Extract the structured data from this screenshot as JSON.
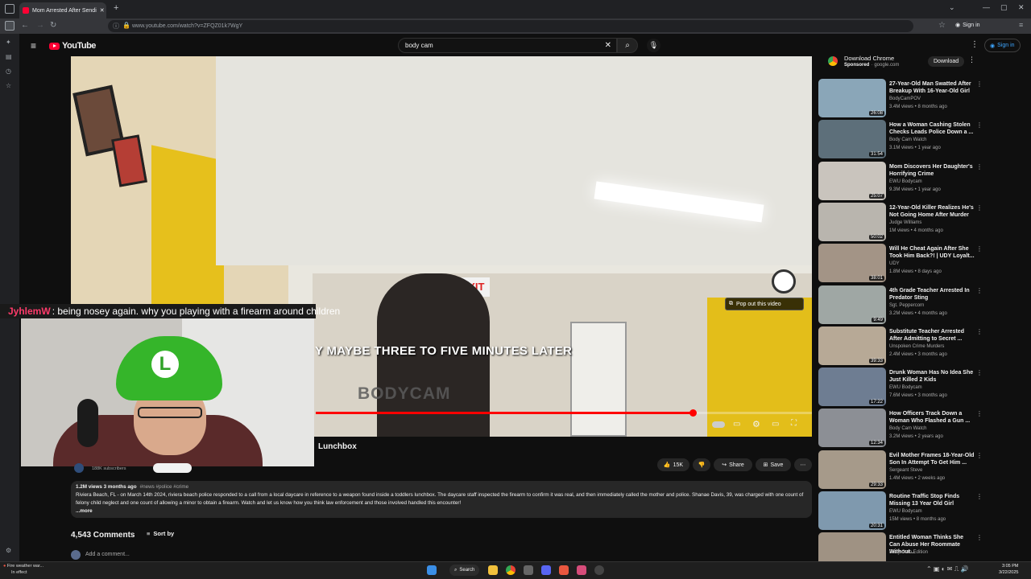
{
  "browser": {
    "tab_title": "Mom Arrested After Sendi",
    "url": "www.youtube.com/watch?v=ZFQZ01k7WgY",
    "new_tab": "+",
    "sign_in": "Sign in"
  },
  "youtube": {
    "logo": "YouTube",
    "search_value": "body cam",
    "sign_in": "Sign in"
  },
  "overlay": {
    "chat_user": "JyhlemW",
    "chat_message": ": being nosey again. why you playing with a firearm around children",
    "caption": "Y MAYBE THREE TO FIVE MINUTES LATER",
    "watermark": "BODYCAM",
    "popout": "Pop out this video",
    "progress": 0.76
  },
  "video": {
    "title_fragment": "Lunchbox",
    "subscribers": "188K subscribers",
    "likes": "15K",
    "share": "Share",
    "save": "Save",
    "views_date": "1.2M views  3 months ago",
    "tags": "#news #police #crime",
    "description": "Riviera Beach, FL - on March 14th 2024, riviera beach police responded to a call from a local daycare in reference to a weapon found inside a toddlers lunchbox. The daycare staff inspected the firearm to confirm it was real, and then immediately called the mother and police. Shanae Davis, 39, was charged with one count of felony child neglect and one count of allowing a minor to obtain a firearm. Watch and let us know how you think law enforcement and those involved handled this encounter!",
    "more": "...more"
  },
  "comments": {
    "count": "4,543 Comments",
    "sort": "Sort by",
    "add": "Add a comment..."
  },
  "ad": {
    "title": "Download Chrome",
    "sponsored": "Sponsored",
    "domain": "google.com",
    "button": "Download"
  },
  "recommendations": [
    {
      "title": "27-Year-Old Man Swatted After Breakup With 16-Year-Old Girl",
      "channel": "BodyCamPOV",
      "meta": "3.4M views • 8 months ago",
      "duration": "26:08",
      "color": "#8aa6b8"
    },
    {
      "title": "How a Woman Cashing Stolen Checks Leads Police Down a ...",
      "channel": "Body Cam Watch",
      "meta": "3.1M views • 1 year ago",
      "duration": "31:54",
      "color": "#5d6f7a"
    },
    {
      "title": "Mom Discovers Her Daughter's Horrifying Crime",
      "channel": "EWU Bodycam",
      "meta": "9.3M views • 1 year ago",
      "duration": "25:07",
      "color": "#c9c4bd"
    },
    {
      "title": "12-Year-Old Killer Realizes He's Not Going Home After Murder",
      "channel": "Judge Williams",
      "meta": "1M views • 4 months ago",
      "duration": "50:02",
      "color": "#b9b5ae"
    },
    {
      "title": "Will He Cheat Again After She Took Him Back?! | UDY Loyalt...",
      "channel": "UDY",
      "meta": "1.8M views • 8 days ago",
      "duration": "38:01",
      "color": "#a39486"
    },
    {
      "title": "4th Grade Teacher Arrested In Predator Sting",
      "channel": "Sgt. Peppercorn",
      "meta": "3.2M views • 4 months ago",
      "duration": "9:49",
      "color": "#9fa7a4"
    },
    {
      "title": "Substitute Teacher Arrested After Admitting to Secret ...",
      "channel": "Unspoken Crime Murders",
      "meta": "2.4M views • 3 months ago",
      "duration": "39:33",
      "color": "#b7a996"
    },
    {
      "title": "Drunk Woman Has No Idea She Just Killed 2 Kids",
      "channel": "EWU Bodycam",
      "meta": "7.6M views • 3 months ago",
      "duration": "17:22",
      "color": "#6e7d92"
    },
    {
      "title": "How Officers Track Down a Woman Who Flashed a Gun ...",
      "channel": "Body Cam Watch",
      "meta": "3.2M views • 2 years ago",
      "duration": "12:34",
      "color": "#8c8f95"
    },
    {
      "title": "Evil Mother Frames 18-Year-Old Son In Attempt To Get Him ...",
      "channel": "Sergeant Steve",
      "meta": "1.4M views • 2 weeks ago",
      "duration": "29:33",
      "color": "#a69a8a"
    },
    {
      "title": "Routine Traffic Stop Finds Missing 13 Year Old Girl",
      "channel": "EWU Bodycam",
      "meta": "15M views • 8 months ago",
      "duration": "20:31",
      "color": "#7f99ae"
    },
    {
      "title": "Entitled Woman Thinks She Can Abuse Her Roommate Without...",
      "channel": "Body Cam Edition",
      "meta": "",
      "duration": "",
      "color": "#9f9283"
    }
  ],
  "taskbar": {
    "weather_line1": "Fire weather war...",
    "weather_line2": "In effect",
    "search": "Search",
    "time": "3:05 PM",
    "date": "3/22/2025"
  },
  "icons": {
    "search": "search-icon",
    "mic": "mic-icon",
    "menu": "hamburger-icon",
    "like": "thumbs-up-icon",
    "dislike": "thumbs-down-icon"
  }
}
